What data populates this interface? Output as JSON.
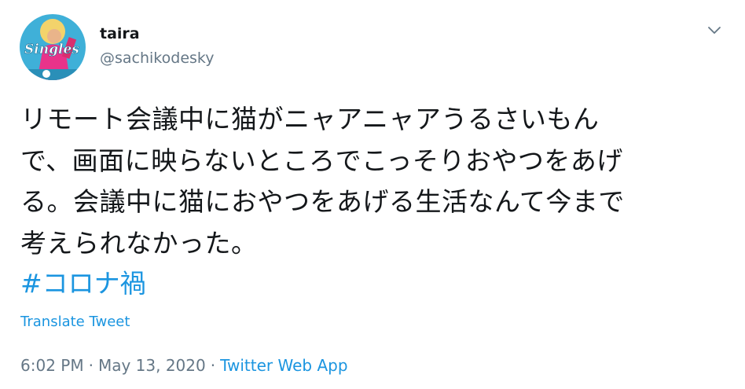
{
  "user": {
    "display_name": "taira",
    "handle": "@sachikodesky",
    "avatar_text": "Singles"
  },
  "tweet": {
    "text_lines": [
      "リモート会議中に猫がニャアニャアうるさいもん",
      "で、画面に映らないところでこっそりおやつをあげ",
      "る。会議中に猫におやつをあげる生活なんて今まで",
      "考えられなかった。"
    ],
    "hashtag": "#コロナ禍",
    "translate_label": "Translate Tweet",
    "time": "6:02 PM",
    "date": "May 13, 2020",
    "separator": "·",
    "source": "Twitter Web App"
  },
  "colors": {
    "link": "#1b95e0",
    "secondary_text": "#657786",
    "primary_text": "#14171a"
  },
  "icons": {
    "menu": "chevron-down-icon"
  }
}
